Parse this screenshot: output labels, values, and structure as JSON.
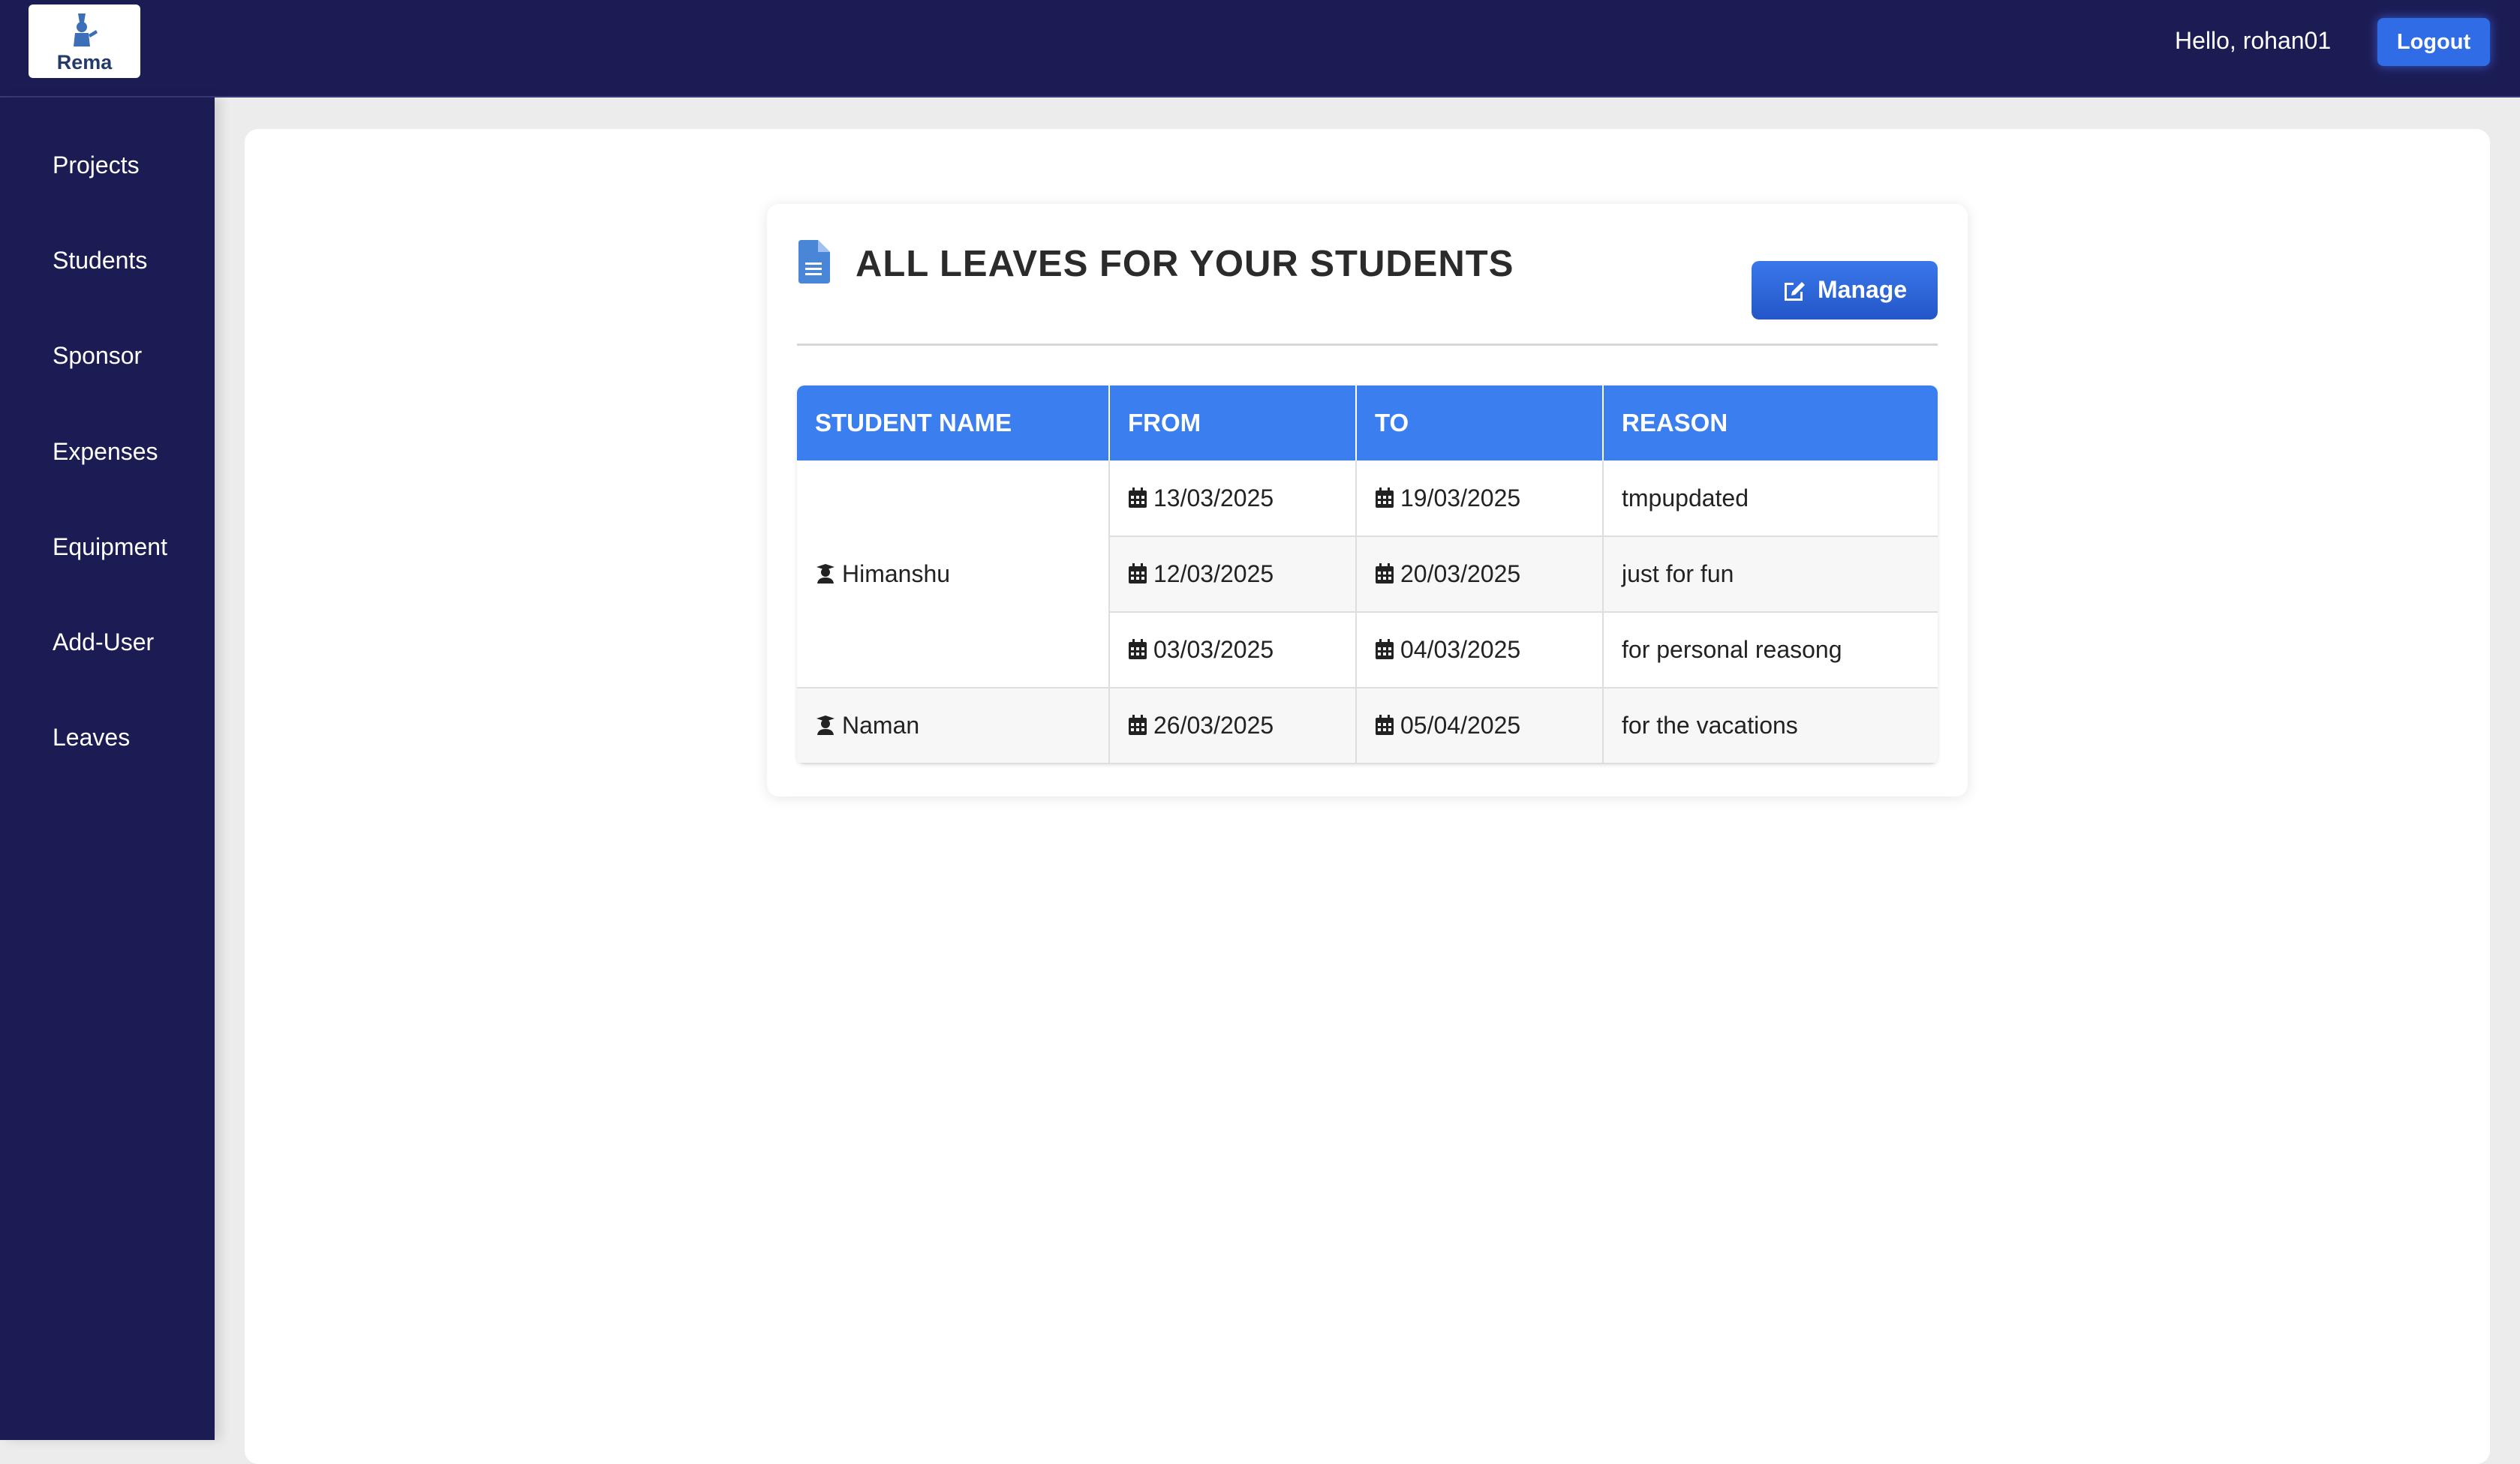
{
  "app": {
    "logo_text": "Rema"
  },
  "header": {
    "greeting": "Hello, rohan01",
    "logout_label": "Logout"
  },
  "sidebar": {
    "items": [
      {
        "label": "Projects"
      },
      {
        "label": "Students"
      },
      {
        "label": "Sponsor"
      },
      {
        "label": "Expenses"
      },
      {
        "label": "Equipment"
      },
      {
        "label": "Add-User"
      },
      {
        "label": "Leaves"
      }
    ]
  },
  "leaves": {
    "title": "ALL LEAVES FOR YOUR STUDENTS",
    "manage_label": "Manage",
    "columns": [
      "STUDENT NAME",
      "FROM",
      "TO",
      "REASON"
    ],
    "students": [
      {
        "name": "Himanshu",
        "leaves": [
          {
            "from": "13/03/2025",
            "to": "19/03/2025",
            "reason": "tmpupdated"
          },
          {
            "from": "12/03/2025",
            "to": "20/03/2025",
            "reason": "just for fun"
          },
          {
            "from": "03/03/2025",
            "to": "04/03/2025",
            "reason": "for personal reasong"
          }
        ]
      },
      {
        "name": "Naman",
        "leaves": [
          {
            "from": "26/03/2025",
            "to": "05/04/2025",
            "reason": "for the vacations"
          }
        ]
      }
    ]
  },
  "colors": {
    "navy": "#1c1c55",
    "accent": "#3b7ef0",
    "button": "#2f6ce5",
    "doc_icon": "#4a86d8"
  },
  "icons": {
    "logo": "graduate-pen-icon",
    "title": "document-icon",
    "manage": "edit-icon",
    "student": "user-graduate-icon",
    "date": "calendar-icon"
  }
}
